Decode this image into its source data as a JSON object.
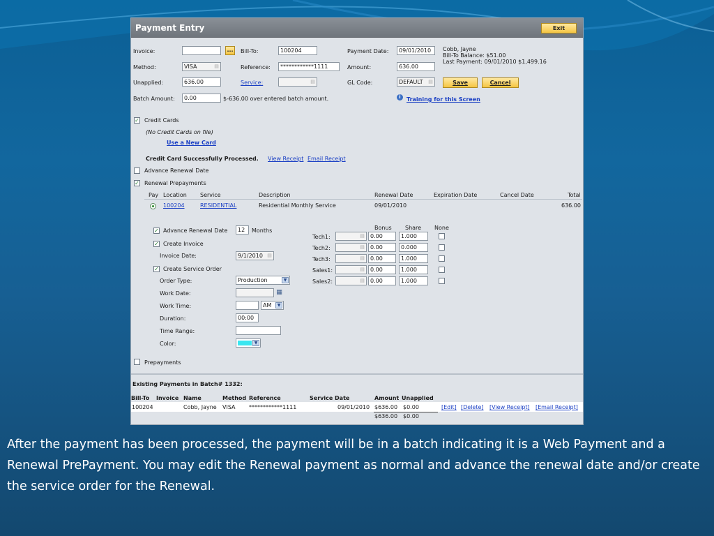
{
  "window": {
    "title": "Payment Entry",
    "exit_label": "Exit"
  },
  "header_form": {
    "invoice_label": "Invoice:",
    "invoice_value": "",
    "lookup_label": "...",
    "method_label": "Method:",
    "method_value": "VISA",
    "unapplied_label": "Unapplied:",
    "unapplied_value": "636.00",
    "batch_amount_label": "Batch Amount:",
    "batch_amount_value": "0.00",
    "batch_note": "$-636.00 over entered batch amount.",
    "bill_to_label": "Bill-To:",
    "bill_to_value": "100204",
    "reference_label": "Reference:",
    "reference_value": "************1111",
    "service_label": "Service:",
    "service_value": "",
    "payment_date_label": "Payment Date:",
    "payment_date_value": "09/01/2010",
    "amount_label": "Amount:",
    "amount_value": "636.00",
    "gl_code_label": "GL Code:",
    "gl_code_value": "DEFAULT",
    "save_label": "Save",
    "cancel_label": "Cancel",
    "customer_name": "Cobb, Jayne",
    "bill_to_balance": "Bill-To Balance: $51.00",
    "last_payment": "Last Payment: 09/01/2010  $1,499.16",
    "training_link": "Training for this Screen"
  },
  "credit_cards": {
    "label": "Credit Cards",
    "none_on_file": "(No Credit Cards on file)",
    "use_new_card": "Use a New Card",
    "success_message": "Credit Card Successfully Processed.",
    "view_receipt": "View Receipt",
    "email_receipt": "Email Receipt"
  },
  "advance_renewal_label": "Advance Renewal Date",
  "renewal_prepayments": {
    "label": "Renewal Prepayments",
    "columns": [
      "Pay",
      "Location",
      "Service",
      "Description",
      "Renewal Date",
      "Expiration Date",
      "Cancel Date",
      "Total"
    ],
    "row": {
      "location": "100204",
      "service": "RESIDENTIAL",
      "description": "Residential Monthly Service",
      "renewal_date": "09/01/2010",
      "total": "636.00"
    }
  },
  "renewal_options": {
    "advance_renewal_label": "Advance Renewal Date",
    "advance_renewal_months": "12",
    "months_label": "Months",
    "create_invoice_label": "Create Invoice",
    "invoice_date_label": "Invoice Date:",
    "invoice_date_value": "9/1/2010",
    "create_service_order_label": "Create Service Order",
    "order_type_label": "Order Type:",
    "order_type_value": "Production",
    "work_date_label": "Work Date:",
    "work_date_value": "",
    "work_time_label": "Work Time:",
    "work_time_value": "",
    "ampm_value": "AM",
    "duration_label": "Duration:",
    "duration_value": "00:00",
    "time_range_label": "Time Range:",
    "time_range_value": "",
    "color_label": "Color:",
    "color_value": "#39e6f0"
  },
  "techs": {
    "headers": {
      "bonus": "Bonus",
      "share": "Share",
      "none": "None"
    },
    "rows": [
      {
        "label": "Tech1:",
        "bonus": "0.00",
        "share": "1.000"
      },
      {
        "label": "Tech2:",
        "bonus": "0.00",
        "share": "0.000"
      },
      {
        "label": "Tech3:",
        "bonus": "0.00",
        "share": "1.000"
      },
      {
        "label": "Sales1:",
        "bonus": "0.00",
        "share": "1.000"
      },
      {
        "label": "Sales2:",
        "bonus": "0.00",
        "share": "1.000"
      }
    ]
  },
  "prepayments_label": "Prepayments",
  "existing": {
    "title": "Existing Payments in Batch# 1332:",
    "columns": {
      "bill_to": "Bill-To",
      "invoice": "Invoice",
      "name": "Name",
      "method": "Method",
      "reference": "Reference",
      "service_date": "Service Date",
      "amount": "Amount",
      "unapplied": "Unapplied"
    },
    "row": {
      "bill_to": "100204",
      "invoice": "",
      "name": "Cobb, Jayne",
      "method": "VISA",
      "reference": "************1111",
      "service_date": "09/01/2010",
      "amount": "$636.00",
      "unapplied": "$0.00"
    },
    "actions": [
      "[Edit]",
      "[Delete]",
      "[View Receipt]",
      "[Email Receipt]"
    ],
    "totals": {
      "amount": "$636.00",
      "unapplied": "$0.00"
    }
  },
  "caption": "After the payment has been processed, the payment will be in a batch indicating it is a Web Payment and a Renewal PrePayment.  You may edit the Renewal payment as normal and advance the renewal date and/or create the service order for the Renewal."
}
